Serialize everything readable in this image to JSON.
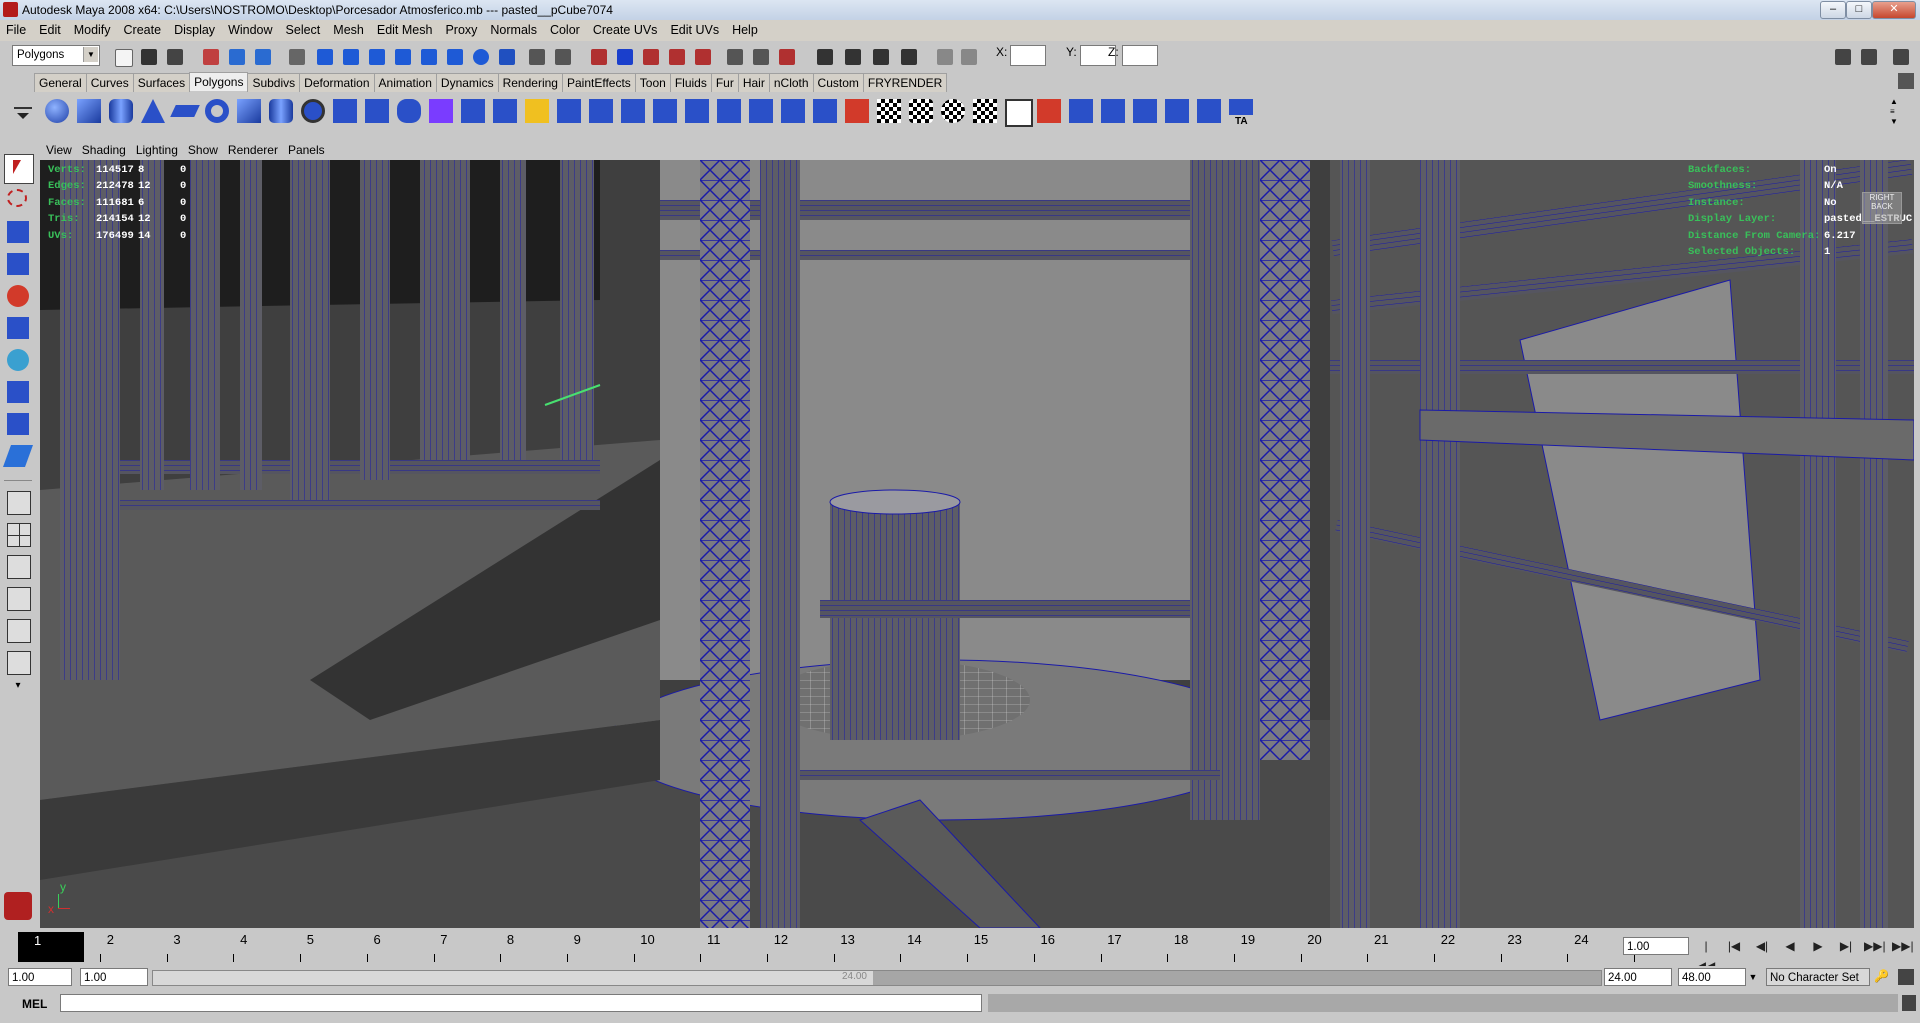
{
  "window": {
    "title": "Autodesk Maya 2008 x64: C:\\Users\\NOSTROMO\\Desktop\\Porcesador Atmosferico.mb  ---  pasted__pCube7074",
    "controls": [
      "–",
      "□",
      "✕"
    ]
  },
  "menubar": [
    "File",
    "Edit",
    "Modify",
    "Create",
    "Display",
    "Window",
    "Select",
    "Mesh",
    "Edit Mesh",
    "Proxy",
    "Normals",
    "Color",
    "Create UVs",
    "Edit UVs",
    "Help"
  ],
  "statusline": {
    "mode": "Polygons",
    "x_label": "X:",
    "y_label": "Y:",
    "z_label": "Z:",
    "x_value": "",
    "y_value": "",
    "z_value": ""
  },
  "shelf": {
    "tabs": [
      "General",
      "Curves",
      "Surfaces",
      "Polygons",
      "Subdivs",
      "Deformation",
      "Animation",
      "Dynamics",
      "Rendering",
      "PaintEffects",
      "Toon",
      "Fluids",
      "Fur",
      "Hair",
      "nCloth",
      "Custom",
      "FRYRENDER"
    ],
    "active_tab": "Polygons",
    "last_icon_label": "TA"
  },
  "panel_menu": [
    "View",
    "Shading",
    "Lighting",
    "Show",
    "Renderer",
    "Panels"
  ],
  "hud_left": [
    {
      "label": "Verts:",
      "a": "114517",
      "b": "8",
      "c": "0"
    },
    {
      "label": "Edges:",
      "a": "212478",
      "b": "12",
      "c": "0"
    },
    {
      "label": "Faces:",
      "a": "111681",
      "b": "6",
      "c": "0"
    },
    {
      "label": "Tris:",
      "a": "214154",
      "b": "12",
      "c": "0"
    },
    {
      "label": "UVs:",
      "a": "176499",
      "b": "14",
      "c": "0"
    }
  ],
  "hud_right": [
    {
      "label": "Backfaces:",
      "value": "On"
    },
    {
      "label": "Smoothness:",
      "value": "N/A"
    },
    {
      "label": "Instance:",
      "value": "No"
    },
    {
      "label": "Display Layer:",
      "value": "pasted__ESTRUC"
    },
    {
      "label": "Distance From Camera:",
      "value": "6.217"
    },
    {
      "label": "Selected Objects:",
      "value": "1"
    }
  ],
  "view_cube": {
    "top": "RIGHT",
    "front": "BACK"
  },
  "axis": {
    "y": "y",
    "x": "x"
  },
  "timeslider": {
    "current_frame": "1",
    "ticks": [
      "1",
      "2",
      "3",
      "4",
      "5",
      "6",
      "7",
      "8",
      "9",
      "10",
      "11",
      "12",
      "13",
      "14",
      "15",
      "16",
      "17",
      "18",
      "19",
      "20",
      "21",
      "22",
      "23",
      "24"
    ],
    "current_time_field": "1.00",
    "playback_buttons": [
      "|◀◀",
      "|◀",
      "◀|",
      "◀",
      "▶",
      "▶|",
      "▶▶|",
      "▶▶|"
    ]
  },
  "range": {
    "start_time": "1.00",
    "playback_start": "1.00",
    "range_text": "24.00",
    "playback_end": "24.00",
    "end_time": "48.00",
    "character_set": "No Character Set"
  },
  "commandline": {
    "label": "MEL",
    "value": ""
  },
  "colors": {
    "wire": "#1a1aa8",
    "hud_green": "#39c05a",
    "ui_gray": "#c8c8c8",
    "viewport_gray": "#6a6a6a"
  }
}
